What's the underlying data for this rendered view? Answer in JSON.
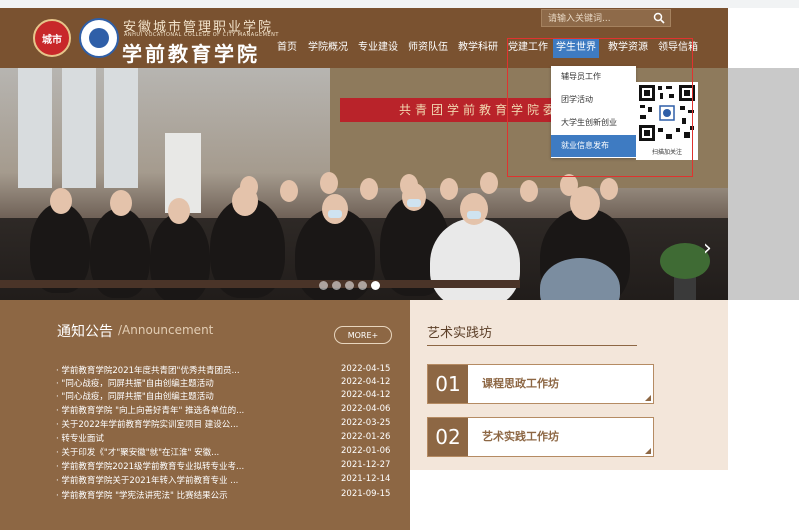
{
  "header": {
    "city_logo_text": "城市",
    "school_name": "安徽城市管理职业学院",
    "school_name_en": "ANHUI VOCATIONAL COLLEGE OF CITY MANAGEMENT",
    "college_name": "学前教育学院",
    "search_placeholder": "请输入关键词...",
    "nav": [
      {
        "label": "首页"
      },
      {
        "label": "学院概况"
      },
      {
        "label": "专业建设"
      },
      {
        "label": "师资队伍"
      },
      {
        "label": "教学科研"
      },
      {
        "label": "党建工作"
      },
      {
        "label": "学生世界",
        "active": true
      },
      {
        "label": "教学资源"
      },
      {
        "label": "领导信箱"
      }
    ]
  },
  "dropdown": {
    "items": [
      {
        "label": "辅导员工作"
      },
      {
        "label": "团学活动"
      },
      {
        "label": "大学生创新创业"
      },
      {
        "label": "就业信息发布",
        "active": true
      }
    ],
    "qr_caption": "扫描加关注"
  },
  "hero": {
    "banner_text": "共青团学前教育学院委员会"
  },
  "announcement": {
    "title": "通知公告",
    "subtitle": "/Announcement",
    "more_label": "MORE+",
    "items": [
      {
        "text": "· 学前教育学院2021年度共青团\"优秀共青团员...",
        "date": "2022-04-15"
      },
      {
        "text": "· \"同心战疫，同屏共振\"自由创编主题活动",
        "date": "2022-04-12"
      },
      {
        "text": "· \"同心战疫，同屏共振\"自由创编主题活动",
        "date": "2022-04-12"
      },
      {
        "text": "· 学前教育学院 \"向上向善好青年\" 推选各单位的...",
        "date": "2022-04-06"
      },
      {
        "text": "· 关于2022年学前教育学院实训室项目 建设公...",
        "date": "2022-03-25"
      },
      {
        "text": "· 转专业面试",
        "date": "2022-01-26"
      },
      {
        "text": "· 关于印发《\"才\"聚安徽\"就\"在江淮\" 安徽...",
        "date": "2022-01-06"
      },
      {
        "text": "· 学前教育学院2021级学前教育专业拟转专业考...",
        "date": "2021-12-27"
      },
      {
        "text": "· 学前教育学院关于2021年转入学前教育专业 ...",
        "date": "2021-12-14"
      },
      {
        "text": "· 学前教育学院 \"学宪法讲宪法\" 比赛结果公示",
        "date": "2021-09-15"
      }
    ]
  },
  "art_practice": {
    "title": "艺术实践坊",
    "workshops": [
      {
        "num": "01",
        "label": "课程思政工作坊"
      },
      {
        "num": "02",
        "label": "艺术实践工作坊"
      }
    ]
  }
}
